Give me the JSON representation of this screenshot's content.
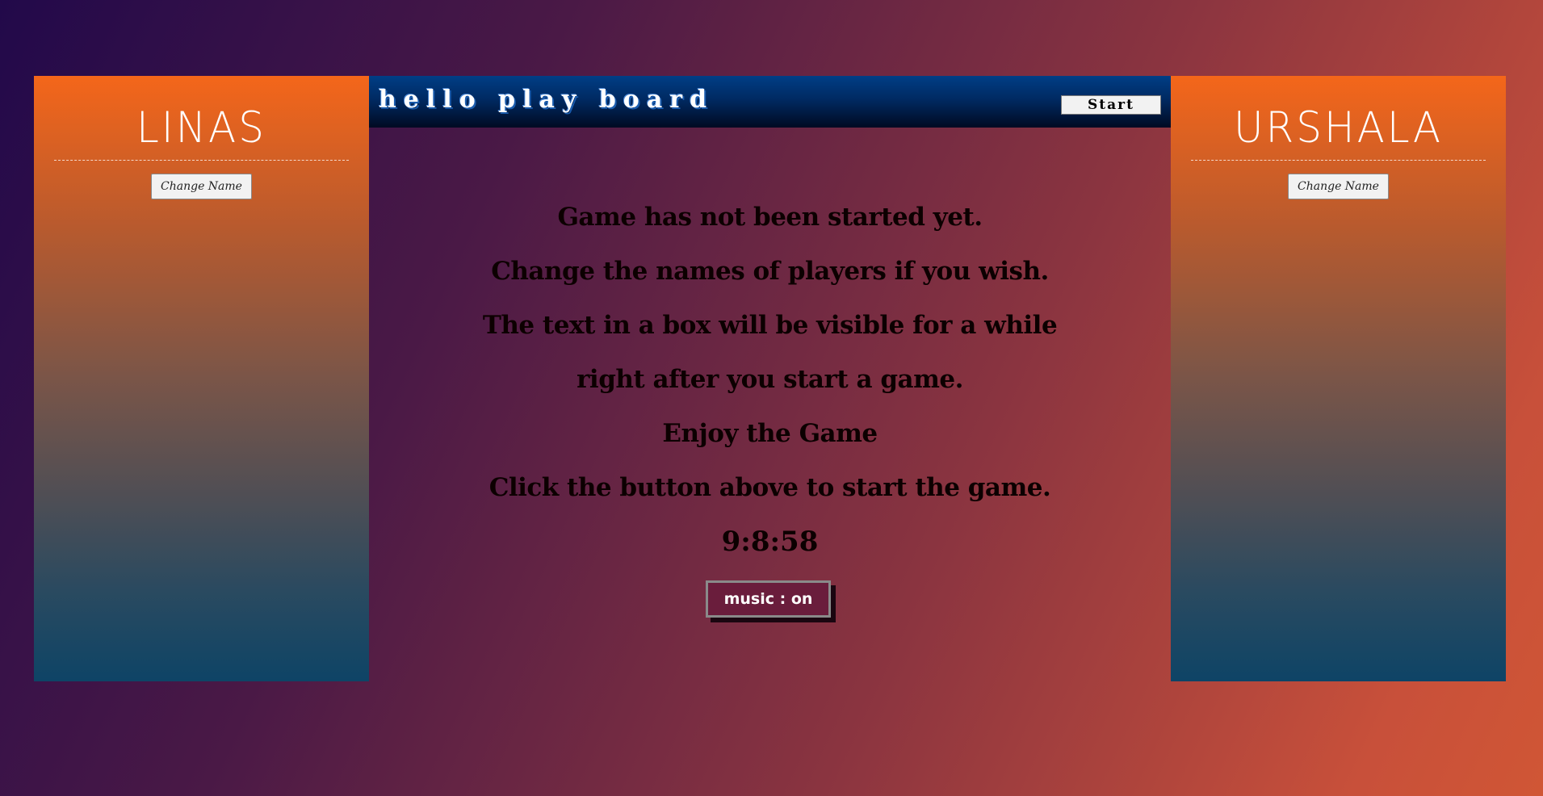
{
  "players": {
    "left": {
      "name": "LINAS",
      "change_label": "Change Name"
    },
    "right": {
      "name": "URSHALA",
      "change_label": "Change Name"
    }
  },
  "board": {
    "title": "hello play board",
    "start_label": "Start",
    "messages": [
      "Game has not been started yet.",
      "Change the names of players if you wish.",
      "The text in a box will be visible for a while",
      "right after you start a game.",
      "Enjoy the Game",
      "Click the button above to start the game."
    ],
    "timer": "9:8:58",
    "music_label": "music : on"
  },
  "colors": {
    "panel_top": "#f4661a",
    "panel_bottom": "#0e4466",
    "header_top": "#003e86",
    "header_bottom": "#000a22",
    "music_button": "#6a1d3c"
  }
}
